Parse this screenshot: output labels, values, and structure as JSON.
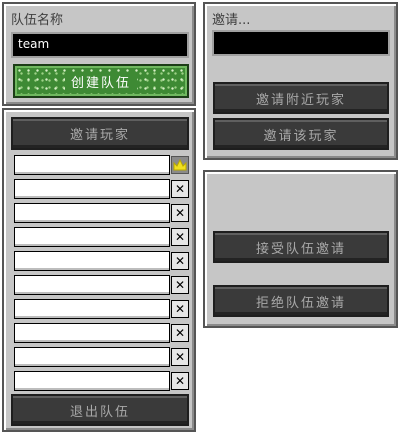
{
  "create_panel": {
    "title": "队伍名称",
    "team_name_value": "team",
    "create_button": "创建队伍"
  },
  "invite_panel": {
    "title": "邀请...",
    "input_value": "",
    "invite_nearby_button": "邀请附近玩家",
    "invite_player_button": "邀请该玩家"
  },
  "respond_panel": {
    "accept_button": "接受队伍邀请",
    "decline_button": "拒绝队伍邀请"
  },
  "members_panel": {
    "invite_button": "邀请玩家",
    "leave_button": "退出队伍",
    "slots": [
      {
        "name": "",
        "action_icon": "crown-icon"
      },
      {
        "name": "",
        "action_icon": "close-icon",
        "glyph": "✕"
      },
      {
        "name": "",
        "action_icon": "close-icon",
        "glyph": "✕"
      },
      {
        "name": "",
        "action_icon": "close-icon",
        "glyph": "✕"
      },
      {
        "name": "",
        "action_icon": "close-icon",
        "glyph": "✕"
      },
      {
        "name": "",
        "action_icon": "close-icon",
        "glyph": "✕"
      },
      {
        "name": "",
        "action_icon": "close-icon",
        "glyph": "✕"
      },
      {
        "name": "",
        "action_icon": "close-icon",
        "glyph": "✕"
      },
      {
        "name": "",
        "action_icon": "close-icon",
        "glyph": "✕"
      },
      {
        "name": "",
        "action_icon": "close-icon",
        "glyph": "✕"
      }
    ]
  },
  "colors": {
    "panel": "#c6c6c6",
    "button": "#3a3a3a",
    "button_text": "#a8a8a8",
    "create_button": "#3e8a34",
    "crown": "#f0e020"
  }
}
